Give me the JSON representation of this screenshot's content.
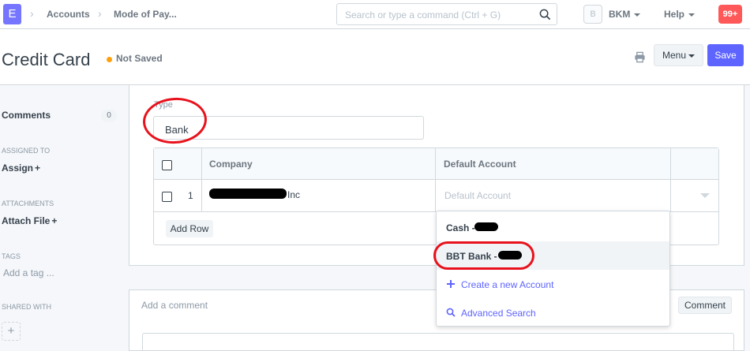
{
  "navbar": {
    "logo_letter": "E",
    "breadcrumbs": [
      "Accounts",
      "Mode of Pay..."
    ],
    "search_placeholder": "Search or type a command (Ctrl + G)",
    "avatar_letter": "B",
    "user_label": "BKM",
    "help_label": "Help",
    "notification_count": "99+"
  },
  "page": {
    "title": "Credit Card",
    "status": "Not Saved",
    "menu_label": "Menu",
    "save_label": "Save"
  },
  "sidebar": {
    "comments_label": "Comments",
    "comments_count": "0",
    "assigned_to_label": "ASSIGNED TO",
    "assign_label": "Assign",
    "attachments_label": "ATTACHMENTS",
    "attach_file_label": "Attach File",
    "tags_label": "TAGS",
    "add_tag_label": "Add a tag ...",
    "shared_with_label": "SHARED WITH",
    "plus": "+"
  },
  "form": {
    "type_label": "Type",
    "type_value": "Bank",
    "table": {
      "columns": [
        "Company",
        "Default Account"
      ],
      "rows": [
        {
          "index": "1",
          "company_suffix": "Inc",
          "default_account_placeholder": "Default Account"
        }
      ],
      "add_row_label": "Add Row"
    }
  },
  "dropdown": {
    "options": [
      "Cash -",
      "BBT Bank -"
    ],
    "create_label": "Create a new Account",
    "advanced_search_label": "Advanced Search"
  },
  "comments": {
    "placeholder": "Add a comment",
    "button_label": "Comment"
  },
  "colors": {
    "primary": "#5e64ff",
    "annotation": "#e8121c",
    "not_saved_dot": "#ffa00a",
    "notification": "#ff5858"
  }
}
